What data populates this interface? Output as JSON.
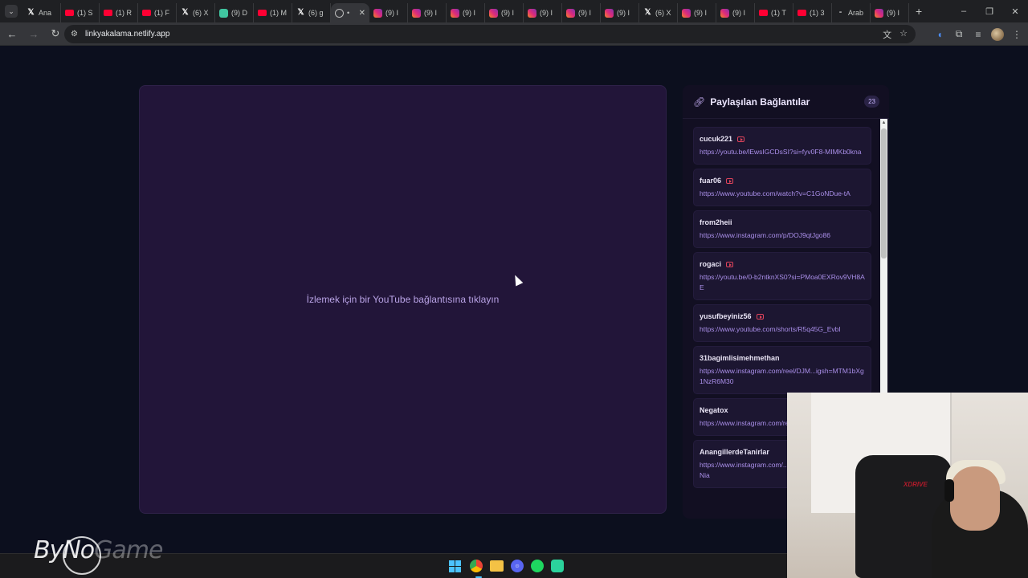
{
  "browser": {
    "tabs": [
      {
        "icon": "x",
        "label": "Ana"
      },
      {
        "icon": "yt",
        "label": "(1) S"
      },
      {
        "icon": "yt",
        "label": "(1) R"
      },
      {
        "icon": "yt",
        "label": "(1) F"
      },
      {
        "icon": "x",
        "label": "(6) X"
      },
      {
        "icon": "dc",
        "label": "(9) D"
      },
      {
        "icon": "yt",
        "label": "(1) M"
      },
      {
        "icon": "x",
        "label": "(6) g"
      },
      {
        "icon": "gl",
        "label": "•",
        "active": true
      },
      {
        "icon": "ig",
        "label": "(9) I"
      },
      {
        "icon": "ig",
        "label": "(9) I"
      },
      {
        "icon": "ig",
        "label": "(9) I"
      },
      {
        "icon": "ig",
        "label": "(9) I"
      },
      {
        "icon": "ig",
        "label": "(9) I"
      },
      {
        "icon": "ig",
        "label": "(9) I"
      },
      {
        "icon": "ig",
        "label": "(9) I"
      },
      {
        "icon": "x",
        "label": "(6) X"
      },
      {
        "icon": "ig",
        "label": "(9) I"
      },
      {
        "icon": "ig",
        "label": "(9) I"
      },
      {
        "icon": "yt",
        "label": "(1) T"
      },
      {
        "icon": "yt",
        "label": "(1) 3"
      },
      {
        "icon": "ar",
        "label": "Arab"
      },
      {
        "icon": "ig",
        "label": "(9) I"
      }
    ],
    "url": "linkyakalama.netlify.app"
  },
  "player": {
    "message": "İzlemek için bir YouTube bağlantısına tıklayın"
  },
  "panel": {
    "title": "Paylaşılan Bağlantılar",
    "count": "23",
    "items": [
      {
        "user": "cucuk221",
        "youtube": true,
        "link": "https://youtu.be/lEwsIGCDsSI?si=fyv0F8-MIMKb0kna"
      },
      {
        "user": "fuar06",
        "youtube": true,
        "link": "https://www.youtube.com/watch?v=C1GoNDue-tA"
      },
      {
        "user": "from2heii",
        "youtube": false,
        "link": "https://www.instagram.com/p/DOJ9qtJgo86"
      },
      {
        "user": "rogaci",
        "youtube": true,
        "link": "https://youtu.be/0-b2ntknXS0?si=PMoa0EXRov9VH8AE"
      },
      {
        "user": "yusufbeyiniz56",
        "youtube": true,
        "link": "https://www.youtube.com/shorts/R5q45G_EvbI"
      },
      {
        "user": "31bagimlisimehmethan",
        "youtube": false,
        "link": "https://www.instagram.com/reel/DJM...igsh=MTM1bXg1NzR6M30"
      },
      {
        "user": "Negatox",
        "youtube": false,
        "link": "https://www.instagram.com/reel/DQJ9xYiCE7M"
      },
      {
        "user": "AnangillerdeTanirlar",
        "youtube": false,
        "link": "https://www.instagram.com/...sh=MXgyeXFrM3YwYmNia"
      }
    ]
  },
  "overlay": {
    "chair_brand": "XDRIVE",
    "watermark": "ByNoGame"
  },
  "colors": {
    "page_bg": "#0c0f1e",
    "player_bg": "#221539",
    "accent": "#a98ee8"
  }
}
